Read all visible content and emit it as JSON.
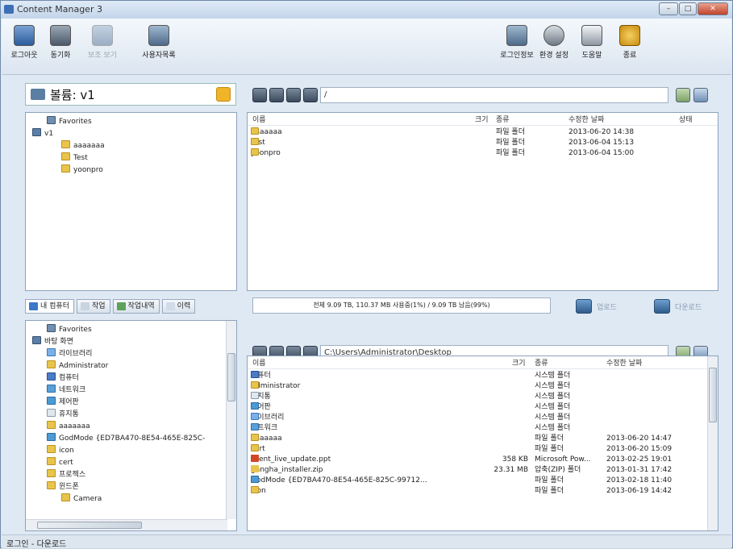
{
  "window": {
    "title": "Content Manager 3",
    "min": "–",
    "max": "□",
    "close": "✕"
  },
  "toolbar": {
    "logout": "로그아웃",
    "sync": "동기화",
    "disabled_item": "보조 보기",
    "user_list": "사용자목록",
    "login_info": "로그인정보",
    "settings": "환경 설정",
    "help": "도움말",
    "exit": "종료"
  },
  "volume": {
    "label": "볼륨: v1"
  },
  "remote": {
    "path": "/",
    "tree": [
      {
        "label": "Favorites",
        "icon": "fav",
        "indent": 1
      },
      {
        "label": "v1",
        "icon": "drv",
        "indent": 0
      },
      {
        "label": "aaaaaaa",
        "icon": "fol",
        "indent": 2
      },
      {
        "label": "Test",
        "icon": "fol",
        "indent": 2
      },
      {
        "label": "yoonpro",
        "icon": "fol",
        "indent": 2
      }
    ],
    "columns": {
      "name": "이름",
      "size": "크기",
      "type": "종류",
      "modified": "수정한 날짜",
      "status": "상태"
    },
    "files": [
      {
        "name": "aaaaaaa",
        "size": "",
        "type": "파일 폴더",
        "modified": "2013-06-20 14:38"
      },
      {
        "name": "Test",
        "size": "",
        "type": "파일 폴더",
        "modified": "2013-06-04 15:13"
      },
      {
        "name": "yoonpro",
        "size": "",
        "type": "파일 폴더",
        "modified": "2013-06-04 15:00"
      }
    ]
  },
  "tabs": {
    "my_computer": "내 컴퓨터",
    "jobs": "작업",
    "history": "작업내역",
    "history2": "이력"
  },
  "usage": {
    "text": "전체 9.09 TB, 110.37 MB 사용중(1%) / 9.09 TB 남음(99%)"
  },
  "transfer": {
    "upload": "업로드",
    "download": "다운로드"
  },
  "local": {
    "path": "C:\\Users\\Administrator\\Desktop",
    "tree": [
      {
        "label": "Favorites",
        "icon": "fav",
        "indent": 1
      },
      {
        "label": "바탕 화면",
        "icon": "drv",
        "indent": 0
      },
      {
        "label": "라이브러리",
        "icon": "lib",
        "indent": 1
      },
      {
        "label": "Administrator",
        "icon": "fol",
        "indent": 1
      },
      {
        "label": "컴퓨터",
        "icon": "cmp",
        "indent": 1
      },
      {
        "label": "네트워크",
        "icon": "net",
        "indent": 1
      },
      {
        "label": "제어판",
        "icon": "cp",
        "indent": 1
      },
      {
        "label": "휴지통",
        "icon": "trs",
        "indent": 1
      },
      {
        "label": "aaaaaaa",
        "icon": "fol",
        "indent": 1
      },
      {
        "label": "GodMode {ED7BA470-8E54-465E-825C-",
        "icon": "cp",
        "indent": 1
      },
      {
        "label": "icon",
        "icon": "fol",
        "indent": 1
      },
      {
        "label": "cert",
        "icon": "fol",
        "indent": 1
      },
      {
        "label": "프로젝스",
        "icon": "fol",
        "indent": 1
      },
      {
        "label": "윈드폰",
        "icon": "fol",
        "indent": 1
      },
      {
        "label": "Camera",
        "icon": "fol",
        "indent": 2
      }
    ],
    "columns": {
      "name": "이름",
      "size": "크기",
      "type": "종류",
      "modified": "수정한 날짜"
    },
    "files": [
      {
        "name": "컴퓨터",
        "icon": "cmp",
        "size": "",
        "type": "시스템 폴더",
        "modified": ""
      },
      {
        "name": "Administrator",
        "icon": "fol",
        "size": "",
        "type": "시스템 폴더",
        "modified": ""
      },
      {
        "name": "휴지통",
        "icon": "trs",
        "size": "",
        "type": "시스템 폴더",
        "modified": ""
      },
      {
        "name": "제어판",
        "icon": "cp",
        "size": "",
        "type": "시스템 폴더",
        "modified": ""
      },
      {
        "name": "라이브러리",
        "icon": "lib",
        "size": "",
        "type": "시스템 폴더",
        "modified": ""
      },
      {
        "name": "네트워크",
        "icon": "net",
        "size": "",
        "type": "시스템 폴더",
        "modified": ""
      },
      {
        "name": "aaaaaaa",
        "icon": "fol",
        "size": "",
        "type": "파일 폴더",
        "modified": "2013-06-20 14:47"
      },
      {
        "name": "cert",
        "icon": "fol",
        "size": "",
        "type": "파일 폴더",
        "modified": "2013-06-20 15:09"
      },
      {
        "name": "client_live_update.ppt",
        "icon": "ppt",
        "size": "358 KB",
        "type": "Microsoft Pow...",
        "modified": "2013-02-25 19:01"
      },
      {
        "name": "gangha_installer.zip",
        "icon": "zip",
        "size": "23.31 MB",
        "type": "압축(ZIP) 폴더",
        "modified": "2013-01-31 17:42"
      },
      {
        "name": "GodMode {ED7BA470-8E54-465E-825C-99712...",
        "icon": "cp",
        "size": "",
        "type": "파일 폴더",
        "modified": "2013-02-18 11:40"
      },
      {
        "name": "icon",
        "icon": "fol",
        "size": "",
        "type": "파일 폴더",
        "modified": "2013-06-19 14:42"
      }
    ]
  },
  "statusbar": {
    "text": "로그인 - 다운로드"
  }
}
